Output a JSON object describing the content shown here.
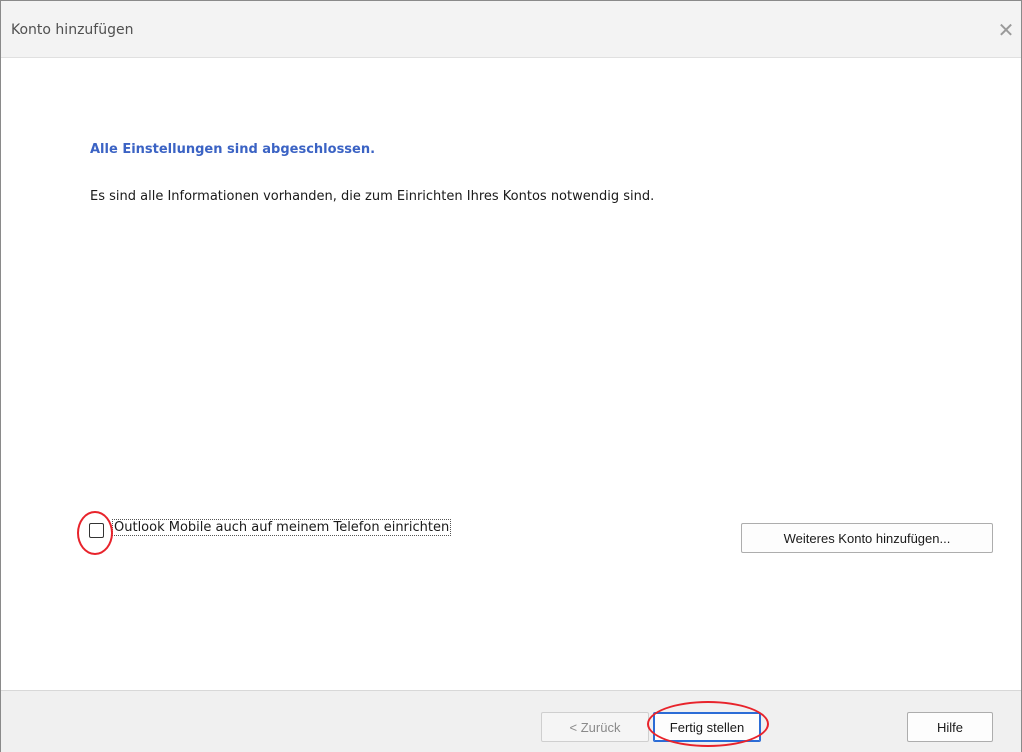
{
  "window": {
    "title": "Konto hinzufügen",
    "close_glyph": "✕"
  },
  "main": {
    "heading": "Alle Einstellungen sind abgeschlossen.",
    "info": "Es sind alle Informationen vorhanden, die zum Einrichten Ihres Kontos notwendig sind."
  },
  "options": {
    "mobile_checkbox_label": "Outlook Mobile auch auf meinem Telefon einrichten",
    "mobile_checkbox_checked": false,
    "add_another_account": "Weiteres Konto hinzufügen..."
  },
  "footer": {
    "back": "< Zurück",
    "finish": "Fertig stellen",
    "help": "Hilfe"
  },
  "colors": {
    "heading_blue": "#3b63c4",
    "annotation_red": "#e8232b",
    "focus_blue": "#2b6cd6"
  }
}
